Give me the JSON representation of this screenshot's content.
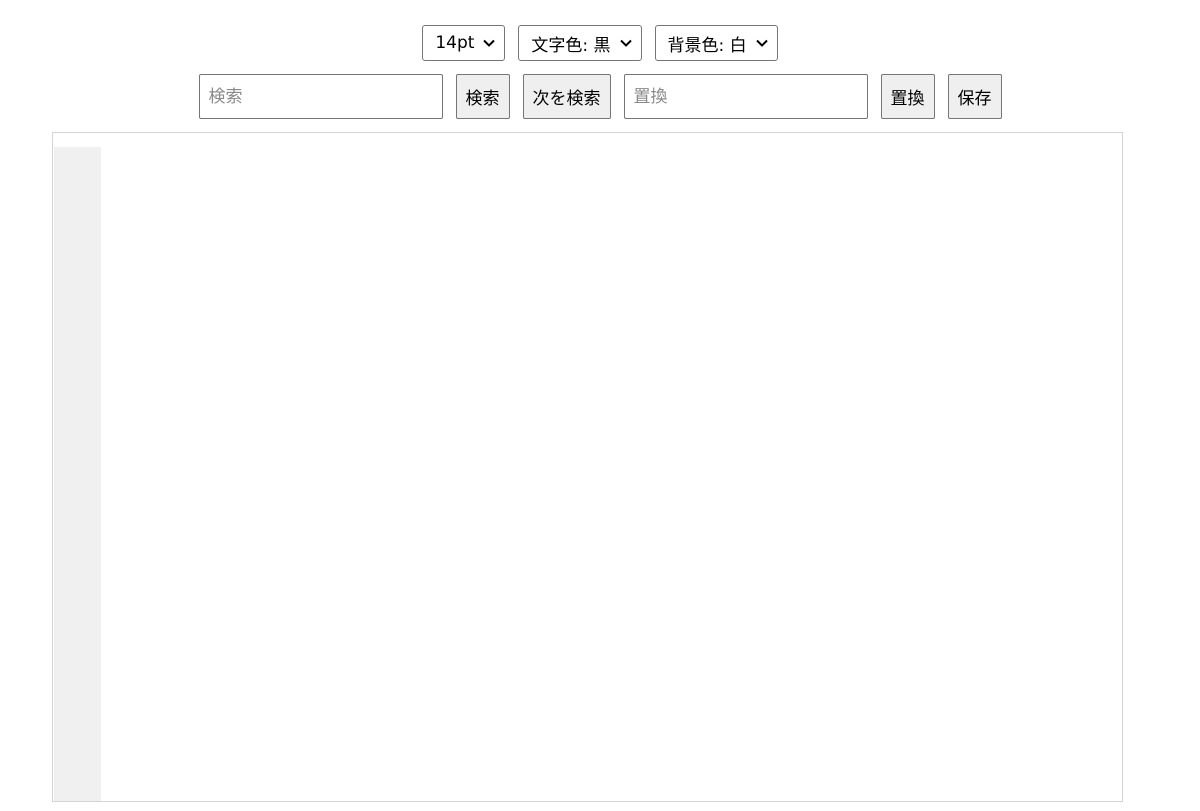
{
  "toolbar": {
    "font_size": {
      "selected": "14pt"
    },
    "text_color": {
      "selected": "文字色: 黒"
    },
    "background_color": {
      "selected": "背景色: 白"
    },
    "search": {
      "placeholder": "検索",
      "value": ""
    },
    "search_button": "検索",
    "find_next_button": "次を検索",
    "replace": {
      "placeholder": "置換",
      "value": ""
    },
    "replace_button": "置換",
    "save_button": "保存"
  },
  "editor": {
    "content": "",
    "colors": {
      "gutter_bg": "#f0f0f0",
      "text_bg": "#ffffff",
      "border": "#d4d4d4"
    }
  }
}
